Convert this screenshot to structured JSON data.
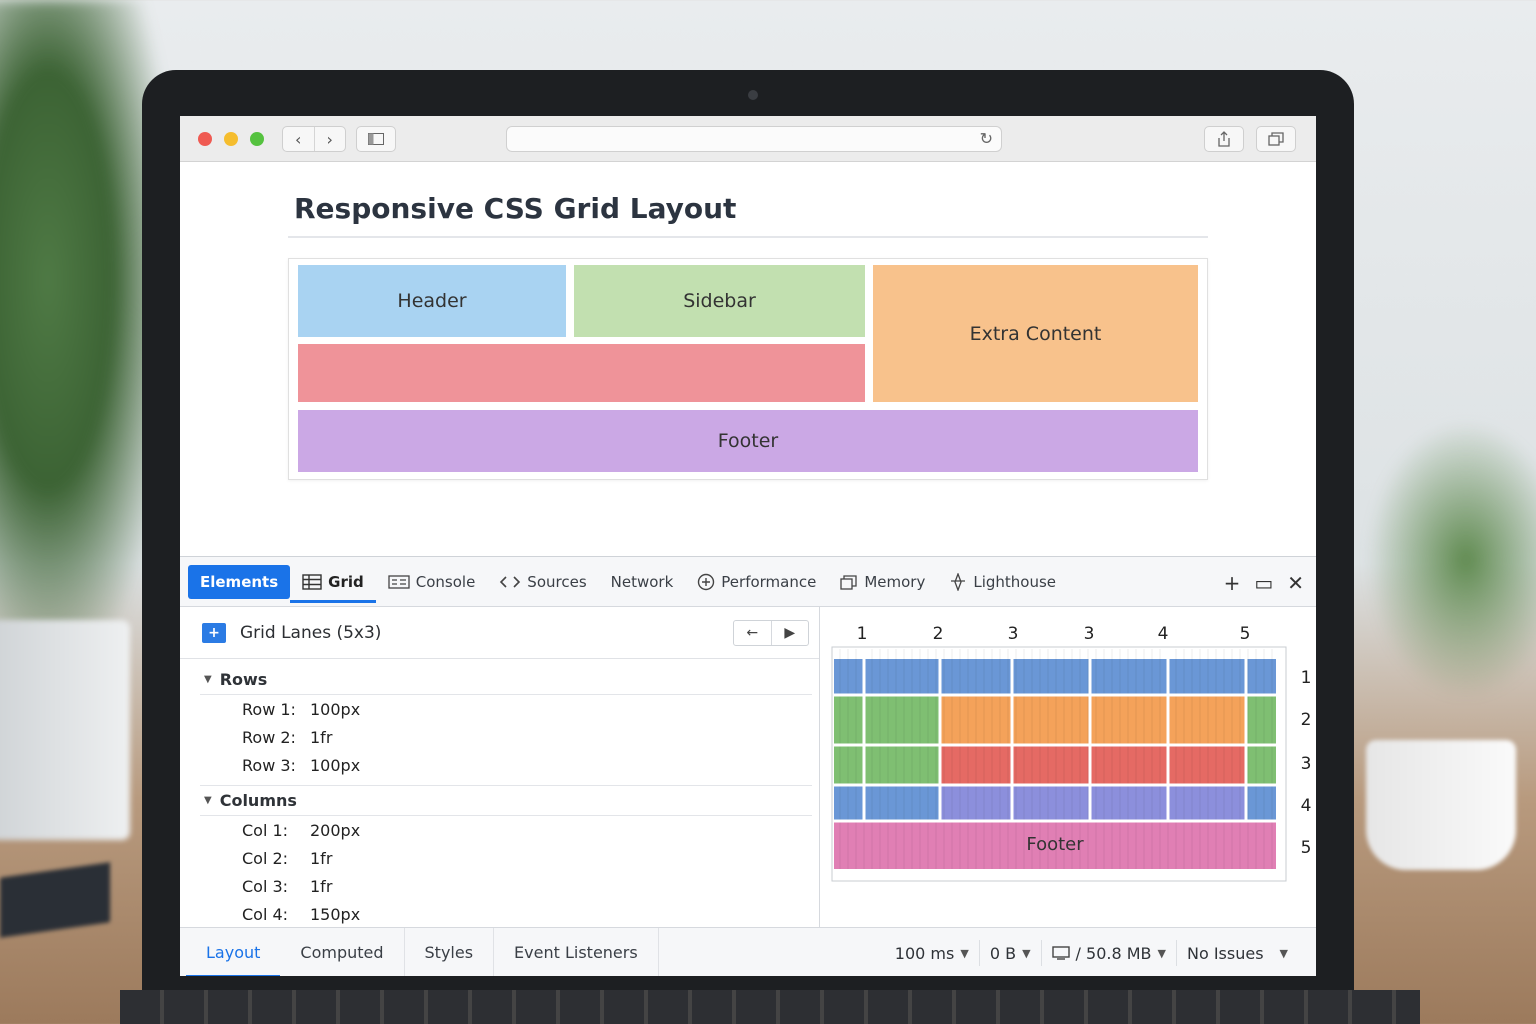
{
  "page": {
    "title": "Responsive CSS Grid Layout",
    "cells": {
      "header": "Header",
      "sidebar": "Sidebar",
      "extra": "Extra Content",
      "main": "",
      "footer": "Footer"
    }
  },
  "browser": {
    "back_icon": "chevron-left-icon",
    "forward_icon": "chevron-right-icon",
    "reload_icon": "reload-icon",
    "reload_glyph": "↻",
    "back_glyph": "‹",
    "forward_glyph": "›"
  },
  "devtools": {
    "tabs": {
      "elements": "Elements",
      "grid": "Grid",
      "console": "Console",
      "sources": "Sources",
      "network": "Network",
      "performance": "Performance",
      "memory": "Memory",
      "lighthouse": "Lighthouse"
    },
    "actions": {
      "add": "+",
      "dock": "▭",
      "close": "✕"
    },
    "panel": {
      "title": "Grid Lanes (5x3)",
      "prev": "←",
      "next": "▶",
      "rows_label": "Rows",
      "rows": [
        {
          "k": "Row 1:",
          "v": "100px"
        },
        {
          "k": "Row 2:",
          "v": "1fr"
        },
        {
          "k": "Row 3:",
          "v": "100px"
        }
      ],
      "columns_label": "Columns",
      "columns": [
        {
          "k": "Col 1:",
          "v": "200px"
        },
        {
          "k": "Col 2:",
          "v": "1fr"
        },
        {
          "k": "Col 3:",
          "v": "1fr"
        },
        {
          "k": "Col 4:",
          "v": "150px"
        }
      ]
    },
    "overlay": {
      "col_numbers": [
        "1",
        "2",
        "3",
        "3",
        "4",
        "5"
      ],
      "row_numbers": [
        "1",
        "2",
        "3",
        "4",
        "5"
      ],
      "footer_label": "Footer",
      "colors": {
        "blue": "#6a97d6",
        "green": "#7fbf72",
        "orange": "#f4a25a",
        "red": "#e56a64",
        "purple": "#8c8fdc",
        "pink": "#e07fb4"
      }
    },
    "bottom_tabs": {
      "layout": "Layout",
      "computed": "Computed",
      "styles": "Styles",
      "event_listeners": "Event Listeners"
    },
    "status": {
      "time": "100 ms",
      "bytes": "0 B",
      "memory": "/ 50.8 MB",
      "issues": "No Issues"
    }
  }
}
